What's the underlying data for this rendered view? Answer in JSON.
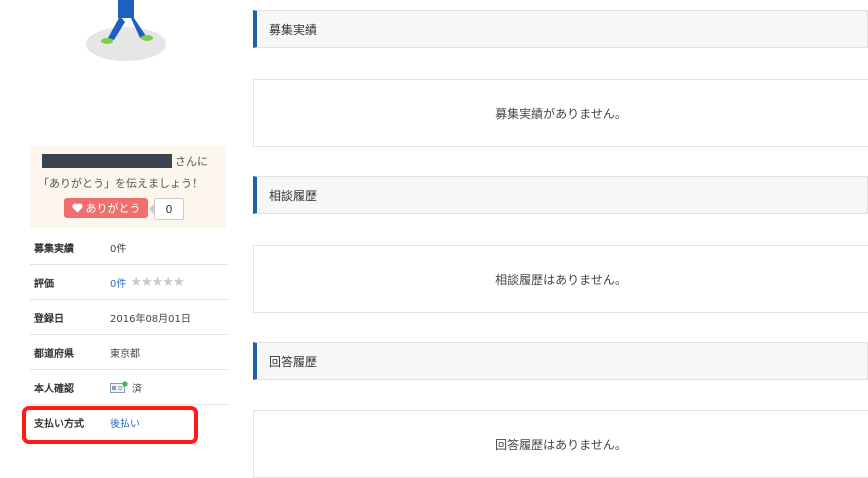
{
  "profile": {
    "thanks": {
      "suffix": "さんに",
      "message": "「ありがとう」を伝えましょう！",
      "button_label": "ありがとう",
      "count": "0"
    },
    "info": [
      {
        "label": "募集実績",
        "value": "0件"
      },
      {
        "label": "評価",
        "value": "0件",
        "stars": "★★★★★",
        "rating_filled": 0,
        "rating_max": 5
      },
      {
        "label": "登録日",
        "value": "2016年08月01日"
      },
      {
        "label": "都道府県",
        "value": "東京都"
      },
      {
        "label": "本人確認",
        "value": "済"
      },
      {
        "label": "支払い方式",
        "value": "後払い"
      }
    ]
  },
  "sections": [
    {
      "title": "募集実績",
      "empty_text": "募集実績がありません。"
    },
    {
      "title": "相談履歴",
      "empty_text": "相談履歴はありません。"
    },
    {
      "title": "回答履歴",
      "empty_text": "回答履歴はありません。"
    }
  ],
  "colors": {
    "accent_bar": "#1f5fae",
    "thanks_button": "#f0706f",
    "highlight": "#ff1a1a",
    "link": "#2a6ebb"
  }
}
